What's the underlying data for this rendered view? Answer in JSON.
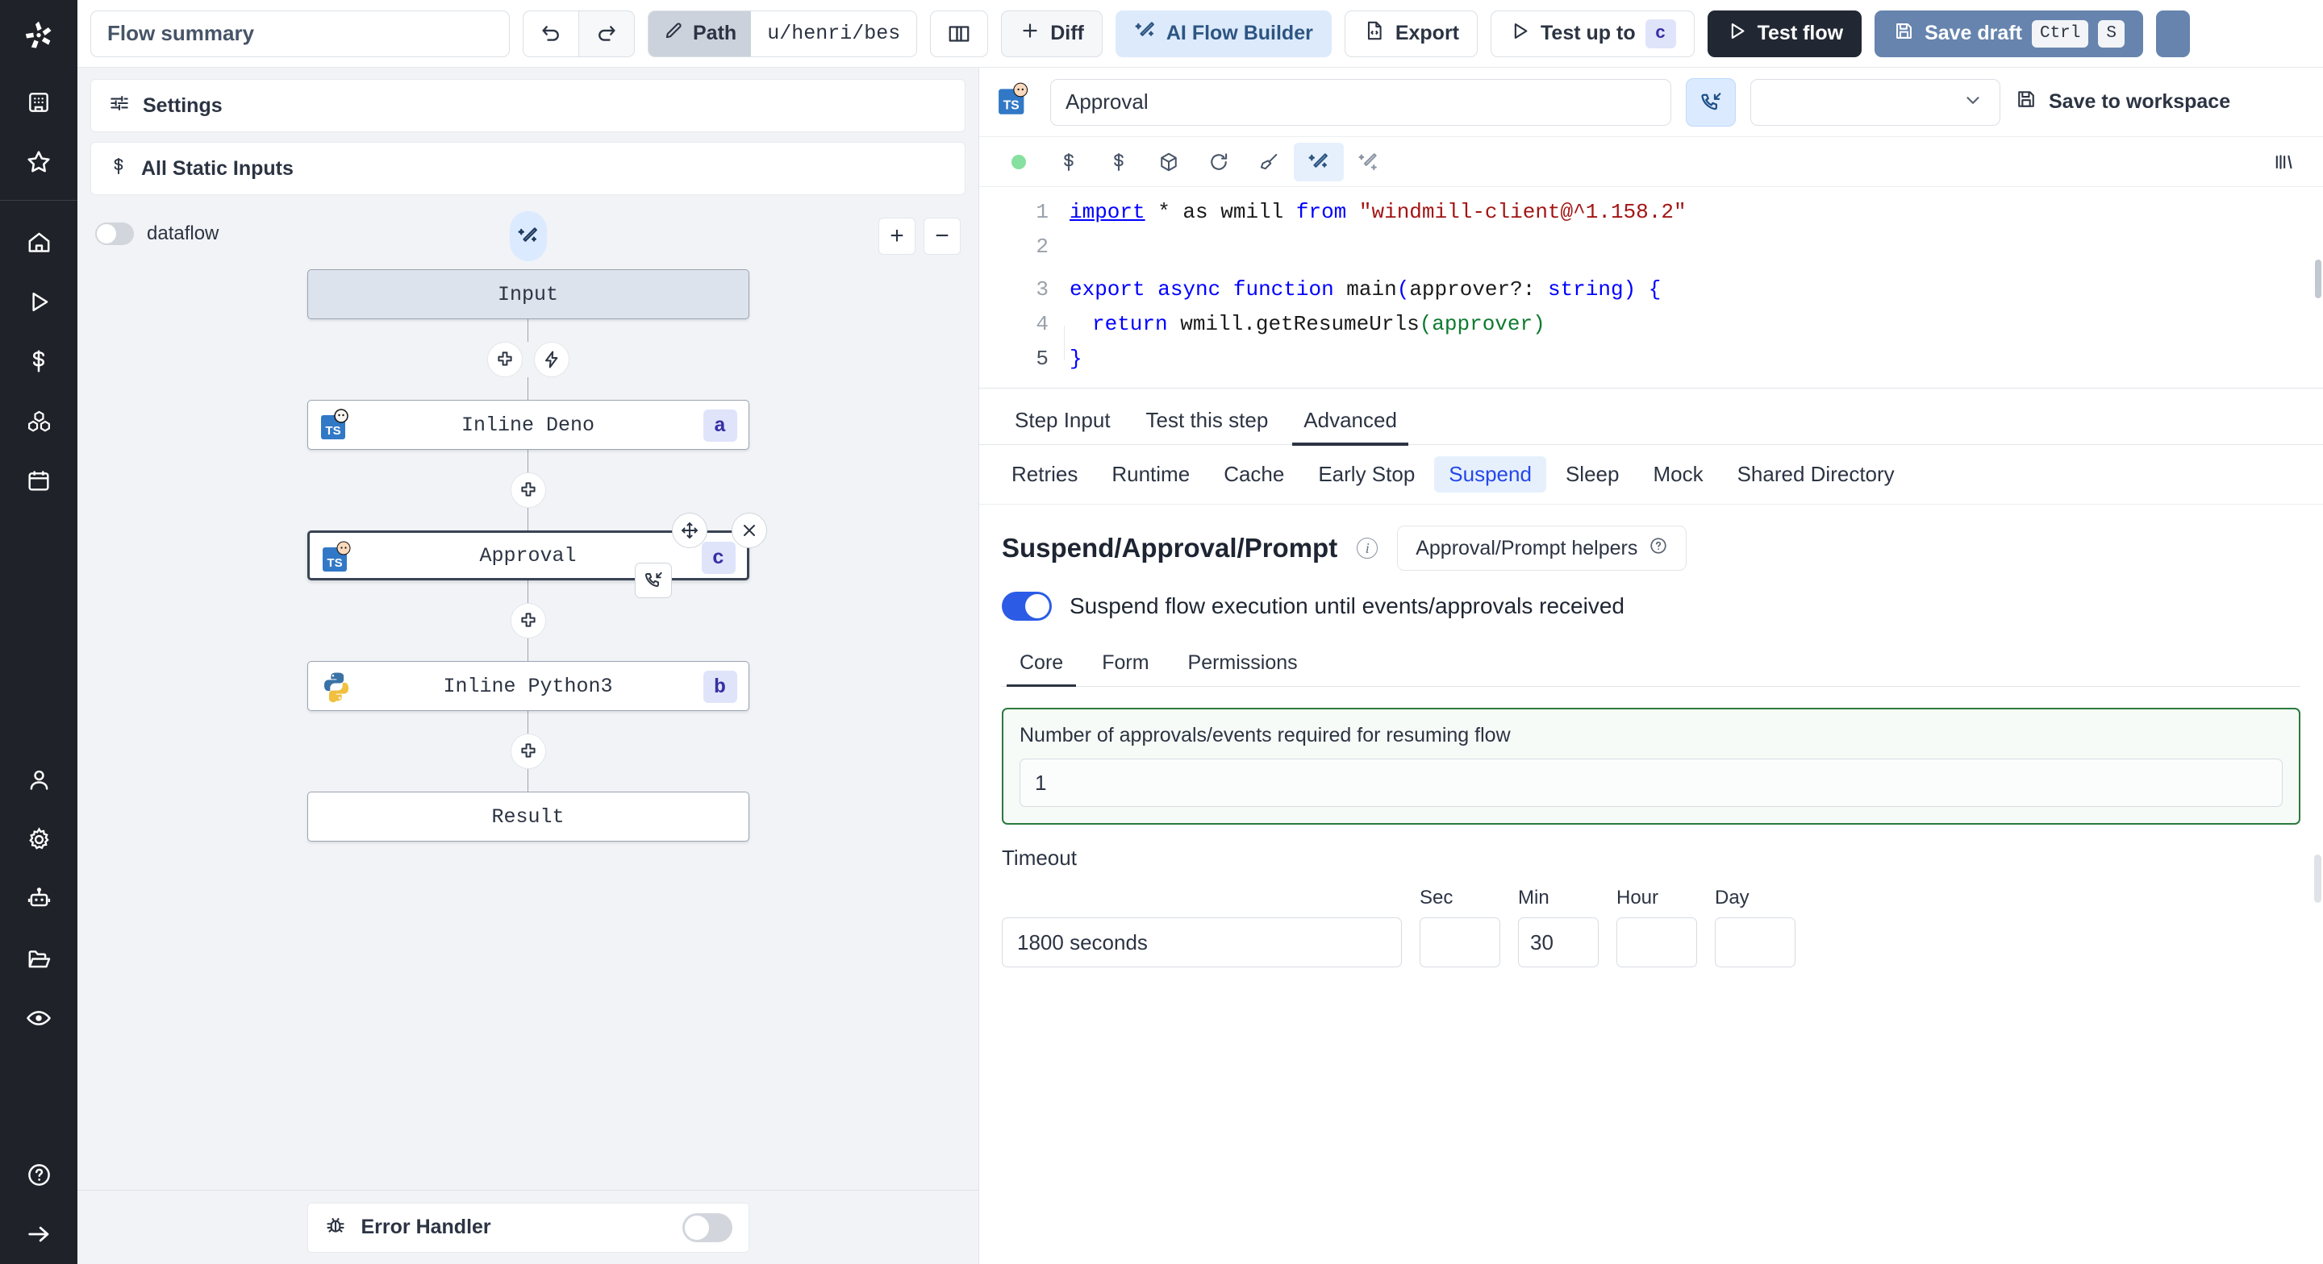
{
  "rail": {
    "logo": "windmill-logo",
    "top_items": [
      {
        "name": "building-icon"
      },
      {
        "name": "star-icon"
      }
    ],
    "main_items": [
      {
        "name": "home-icon"
      },
      {
        "name": "play-icon"
      },
      {
        "name": "dollar-icon"
      },
      {
        "name": "blocks-icon"
      },
      {
        "name": "calendar-icon"
      }
    ],
    "lower_items": [
      {
        "name": "user-icon"
      },
      {
        "name": "gear-icon"
      },
      {
        "name": "robot-icon"
      },
      {
        "name": "folder-icon"
      },
      {
        "name": "eye-icon"
      }
    ],
    "bottom_items": [
      {
        "name": "help-circle-icon"
      },
      {
        "name": "arrow-right-icon"
      }
    ]
  },
  "topbar": {
    "summary_value": "Flow summary",
    "summary_placeholder": "Flow summary",
    "undo_label": "undo",
    "redo_label": "redo",
    "path_label": "Path",
    "path_value": "u/henri/bes",
    "book_label": "book",
    "diff_label": "Diff",
    "ai_flow_builder_label": "AI Flow Builder",
    "export_label": "Export",
    "test_up_to_label": "Test up to",
    "test_up_to_step": "c",
    "test_flow_label": "Test flow",
    "save_draft_label": "Save draft",
    "save_draft_kbd_ctrl": "Ctrl",
    "save_draft_kbd_key": "S"
  },
  "flow_panel": {
    "accordions": [
      {
        "label": "Settings",
        "icon": "sliders-icon"
      },
      {
        "label": "All Static Inputs",
        "icon": "dollar-icon"
      }
    ],
    "dataflow_toggle_label": "dataflow",
    "dataflow_toggle_on": false,
    "zoom_in_label": "+",
    "zoom_out_label": "−",
    "ai_badge_icon": "magic-wand-icon",
    "nodes": [
      {
        "label": "Input",
        "letter": "",
        "lang": "",
        "selected": false,
        "kind": "input"
      },
      {
        "label": "Inline Deno",
        "letter": "a",
        "lang": "typescript",
        "selected": false,
        "kind": "step"
      },
      {
        "label": "Approval",
        "letter": "c",
        "lang": "typescript",
        "selected": true,
        "kind": "step"
      },
      {
        "label": "Inline Python3",
        "letter": "b",
        "lang": "python",
        "selected": false,
        "kind": "step"
      },
      {
        "label": "Result",
        "letter": "",
        "lang": "",
        "selected": false,
        "kind": "result"
      }
    ],
    "error_handler": {
      "label": "Error Handler",
      "icon": "bug-icon",
      "enabled": false
    }
  },
  "detail": {
    "name_value": "Approval",
    "name_placeholder": "Approval",
    "phone_button_icon": "phone-incoming-icon",
    "select_value": "",
    "save_to_workspace_label": "Save to workspace",
    "editor_toolbar": [
      {
        "name": "status-dot"
      },
      {
        "name": "dollar-icon"
      },
      {
        "name": "dollar-icon-2"
      },
      {
        "name": "package-icon"
      },
      {
        "name": "refresh-icon"
      },
      {
        "name": "broom-icon"
      },
      {
        "name": "magic-wand-icon",
        "active": true
      },
      {
        "name": "sparkles-icon"
      },
      {
        "name": "history-icon"
      }
    ],
    "code_lines": [
      {
        "n": "1",
        "text": "import * as wmill from \"windmill-client@^1.158.2\""
      },
      {
        "n": "2",
        "text": ""
      },
      {
        "n": "3",
        "text": "export async function main(approver?: string) {"
      },
      {
        "n": "4",
        "text": "  return wmill.getResumeUrls(approver)"
      },
      {
        "n": "5",
        "text": "}"
      }
    ],
    "tabs": [
      {
        "label": "Step Input",
        "active": false
      },
      {
        "label": "Test this step",
        "active": false
      },
      {
        "label": "Advanced",
        "active": true
      }
    ],
    "subtabs": [
      {
        "label": "Retries",
        "active": false
      },
      {
        "label": "Runtime",
        "active": false
      },
      {
        "label": "Cache",
        "active": false
      },
      {
        "label": "Early Stop",
        "active": false
      },
      {
        "label": "Suspend",
        "active": true
      },
      {
        "label": "Sleep",
        "active": false
      },
      {
        "label": "Mock",
        "active": false
      },
      {
        "label": "Shared Directory",
        "active": false
      }
    ],
    "suspend": {
      "section_title": "Suspend/Approval/Prompt",
      "helpers_button_label": "Approval/Prompt helpers",
      "toggle_on": true,
      "toggle_label": "Suspend flow execution until events/approvals received",
      "mode_tabs": [
        {
          "label": "Core",
          "active": true
        },
        {
          "label": "Form",
          "active": false
        },
        {
          "label": "Permissions",
          "active": false
        }
      ],
      "approvals_field_label": "Number of approvals/events required for resuming flow",
      "approvals_value": "1",
      "timeout_title": "Timeout",
      "timeout_value": "1800 seconds",
      "units": [
        {
          "label": "Sec",
          "value": ""
        },
        {
          "label": "Min",
          "value": "30"
        },
        {
          "label": "Hour",
          "value": ""
        },
        {
          "label": "Day",
          "value": ""
        }
      ]
    }
  },
  "colors": {
    "accent_blue": "#2c5ce6",
    "rail_bg": "#1f2329",
    "dark_button": "#222833",
    "save_button": "#6684ae",
    "green_border": "#2b7a3d",
    "status_dot": "#86e0a0"
  }
}
